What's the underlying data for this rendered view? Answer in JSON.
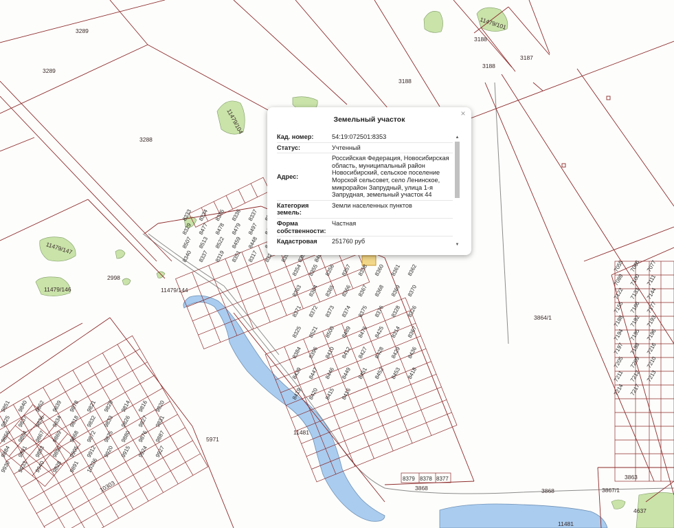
{
  "popup": {
    "title": "Земельный участок",
    "close": "×",
    "rows": [
      {
        "key": "Кад. номер:",
        "value": "54:19:072501:8353"
      },
      {
        "key": "Статус:",
        "value": "Учтенный"
      },
      {
        "key": "Адрес:",
        "value": "Российская Федерация, Новосибирская область, муниципальный район Новосибирский, сельское поселение Морской сельсовет, село Ленинское, микрорайон Запрудный, улица 1-я Запрудная, земельный участок 44"
      },
      {
        "key": "Категория земель:",
        "value": "Земли населенных пунктов"
      },
      {
        "key": "Форма собственности:",
        "value": "Частная"
      },
      {
        "key": "Кадастровая стоимость:",
        "value": "251760 руб"
      }
    ],
    "scroll_up": "▲",
    "scroll_down": "▼"
  },
  "map": {
    "colors": {
      "background": "#fdfdfb",
      "parcel_line": "#8c2a2a",
      "water": "#a9ccef",
      "vegetation": "#c9e3a9",
      "road": "#8a8a8a"
    },
    "labels": {
      "l3289a": "3289",
      "l3289b": "3289",
      "l3288": "3288",
      "l11479_104": "11479/104",
      "l11479_101": "11479/101",
      "l3188a": "3188",
      "l3188b": "3188",
      "l3188c": "3188",
      "l3187": "3187",
      "l11479_147": "11479/147",
      "l11479_146": "11479/146",
      "l2998": "2998",
      "l11479_144": "11479/144",
      "l3864_1": "3864/1",
      "l5971": "5971",
      "l11481a": "11481",
      "l11481b": "11481",
      "l3868a": "3868",
      "l3868b": "3868",
      "l3863": "3863",
      "l3867_1": "3867/1",
      "l4637": "4637",
      "l10303": "10303",
      "l8379": "8379",
      "l8378": "8378",
      "l8377": "8377"
    },
    "block_north": [
      "8333",
      "8334",
      "8335",
      "8336",
      "8337",
      "8332",
      "8464",
      "8458",
      "8330",
      "8329",
      "8477",
      "8478",
      "8479",
      "8497",
      "8498",
      "8490",
      "8502",
      "8526",
      "8507",
      "8513",
      "8522",
      "8459",
      "8448",
      "8437",
      "8403",
      "8392",
      "8370",
      "8340",
      "8337",
      "8319",
      "8351",
      "8317",
      "8320",
      "8395",
      "8384",
      "8460"
    ],
    "block_south": [
      "8354",
      "8355",
      "8356",
      "8357",
      "8358",
      "8360",
      "8361",
      "8362",
      "8363",
      "8364",
      "8365",
      "8366",
      "8367",
      "8368",
      "8369",
      "8370",
      "8371",
      "8372",
      "8373",
      "8374",
      "8375",
      "8376",
      "8328",
      "8326",
      "8325",
      "8521",
      "8500",
      "8489",
      "8476",
      "8425",
      "8314",
      "8367",
      "8384",
      "8396",
      "8410",
      "8412",
      "8427",
      "8428",
      "8429",
      "8436",
      "8439",
      "8447",
      "8446",
      "8449",
      "8451",
      "8452",
      "8453",
      "8418",
      "8419",
      "8420",
      "8415",
      "8416"
    ],
    "block_east": [
      "7055",
      "7066",
      "7077",
      "7089",
      "7100",
      "7111",
      "7122",
      "7133",
      "7144",
      "7155",
      "7166",
      "7177",
      "7188",
      "7192",
      "7193",
      "7194",
      "7195",
      "7196",
      "7197",
      "7198",
      "7216",
      "7205",
      "7209",
      "7210",
      "7211",
      "7212",
      "7213",
      "7214",
      "7217"
    ],
    "block_southwest": [
      "9851",
      "9840",
      "9852",
      "9839",
      "9878",
      "9821",
      "9828",
      "9814",
      "9816",
      "9820",
      "9825",
      "9837",
      "9836",
      "9834",
      "9818",
      "9832",
      "9833",
      "9826",
      "9827",
      "9831",
      "9856",
      "9864",
      "9867",
      "9869",
      "9868",
      "9872",
      "9875",
      "9880",
      "9876",
      "9887",
      "9884",
      "9891",
      "9893",
      "9892",
      "9905",
      "9912",
      "9920",
      "9915",
      "9924",
      "9927",
      "9930",
      "9933",
      "9940",
      "9828",
      "9891",
      "10336"
    ]
  }
}
